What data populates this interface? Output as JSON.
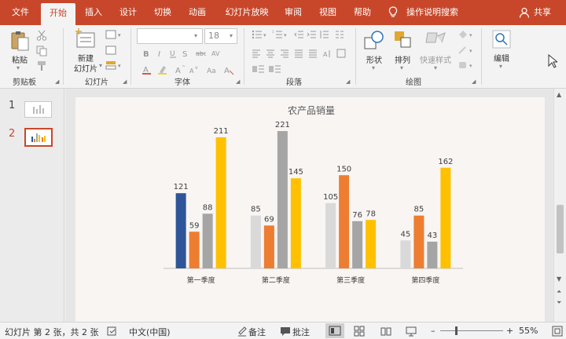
{
  "menu": {
    "items": [
      {
        "label": "文件",
        "active": false
      },
      {
        "label": "开始",
        "active": true
      },
      {
        "label": "插入",
        "active": false
      },
      {
        "label": "设计",
        "active": false
      },
      {
        "label": "切换",
        "active": false
      },
      {
        "label": "动画",
        "active": false
      },
      {
        "label": "幻灯片放映",
        "active": false
      },
      {
        "label": "审阅",
        "active": false
      },
      {
        "label": "视图",
        "active": false
      },
      {
        "label": "帮助",
        "active": false
      }
    ],
    "search_label": "操作说明搜索",
    "share_label": "共享"
  },
  "ribbon": {
    "paste_label": "粘贴",
    "new_slide_line1": "新建",
    "new_slide_line2": "幻灯片",
    "font_size": "18",
    "shape_label": "形状",
    "arrange_label": "排列",
    "quick_style_label": "快速样式",
    "edit_label": "编辑",
    "groups": {
      "clipboard": "剪贴板",
      "slides": "幻灯片",
      "font": "字体",
      "paragraph": "段落",
      "drawing": "绘图"
    }
  },
  "thumbnails": [
    {
      "number": "1",
      "selected": false
    },
    {
      "number": "2",
      "selected": true
    }
  ],
  "status": {
    "slide_info": "幻灯片 第 2 张，共 2 张",
    "language": "中文(中国)",
    "notes_label": "备注",
    "comments_label": "批注",
    "zoom_value": "55%",
    "zoom_fraction": 0.55
  },
  "chart_data": {
    "type": "bar",
    "title": "农产品销量",
    "categories": [
      "第一季度",
      "第二季度",
      "第三季度",
      "第四季度"
    ],
    "series": [
      {
        "color_first": "#2e5597",
        "color": "#d9d9d9",
        "values": [
          121,
          85,
          105,
          45
        ]
      },
      {
        "color": "#ed7d31",
        "values": [
          59,
          69,
          150,
          85
        ]
      },
      {
        "color": "#a5a5a5",
        "values": [
          88,
          221,
          76,
          43
        ]
      },
      {
        "color": "#ffc000",
        "values": [
          211,
          145,
          78,
          162
        ]
      }
    ],
    "ylim": [
      0,
      240
    ],
    "grid": false,
    "legend": "none"
  }
}
